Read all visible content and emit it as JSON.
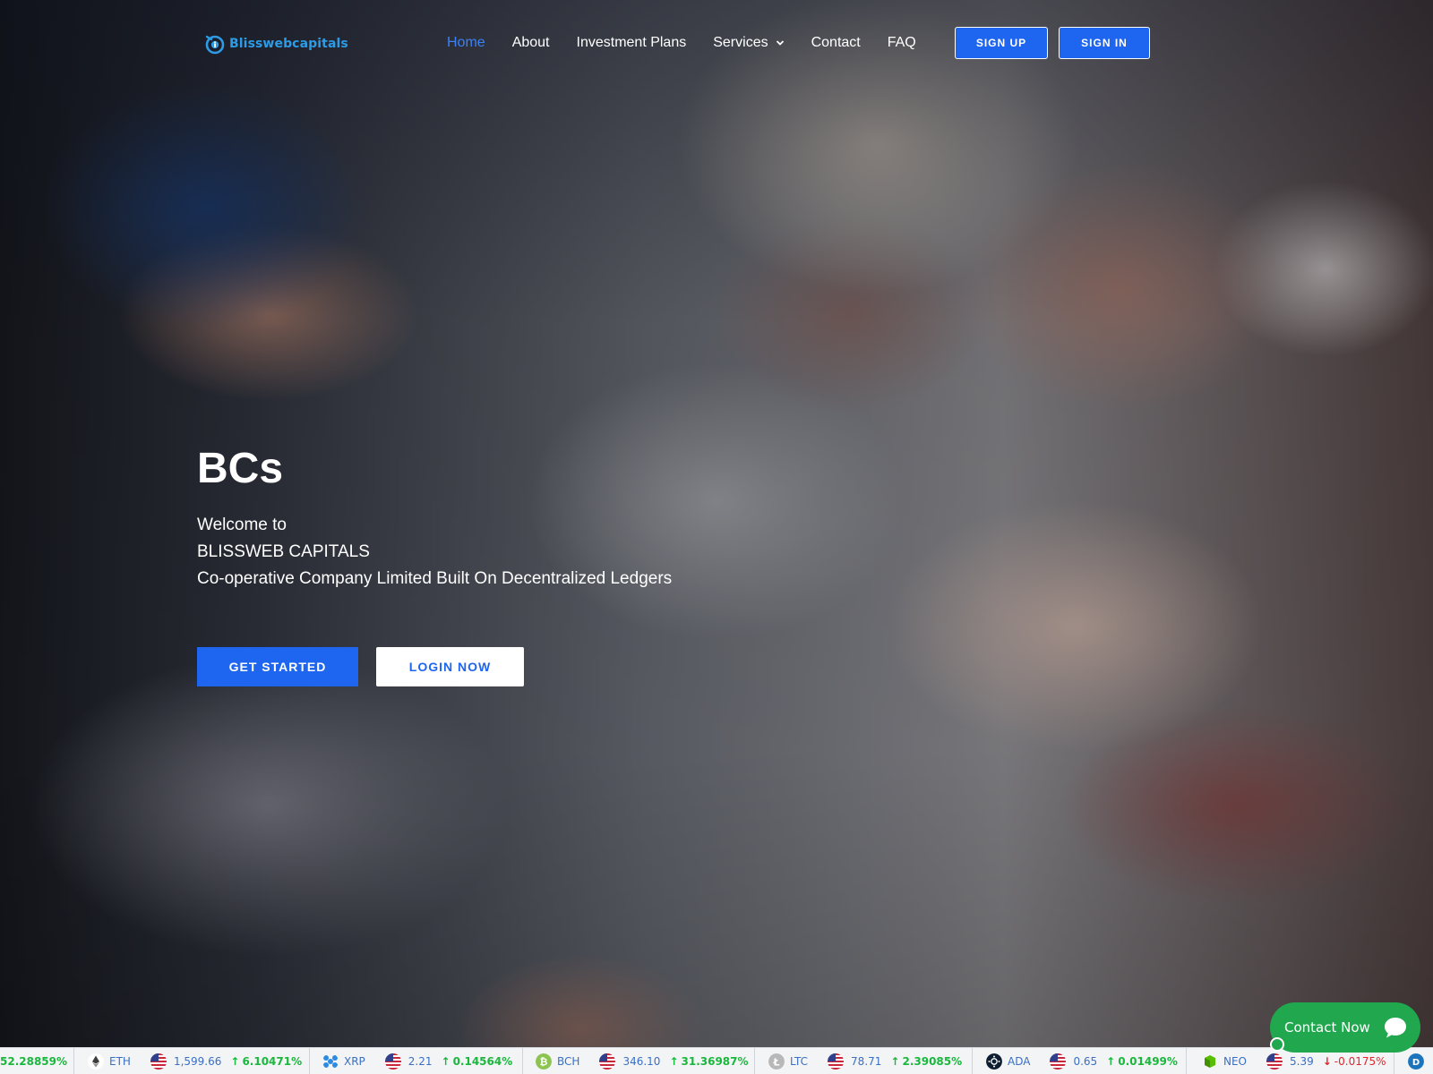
{
  "brand": {
    "name": "Blisswebcapitals",
    "color": "#2d9be6"
  },
  "nav": {
    "items": [
      {
        "label": "Home",
        "active": true
      },
      {
        "label": "About"
      },
      {
        "label": "Investment Plans"
      },
      {
        "label": "Services",
        "has_dropdown": true
      },
      {
        "label": "Contact"
      },
      {
        "label": "FAQ"
      }
    ],
    "signup": "SIGN UP",
    "signin": "SIGN IN"
  },
  "hero": {
    "title": "BCs",
    "line1": "Welcome to",
    "line2": "BLISSWEB CAPITALS",
    "line3": "Co-operative Company Limited Built On Decentralized Ledgers",
    "cta_primary": "GET STARTED",
    "cta_secondary": "LOGIN NOW"
  },
  "ticker": {
    "partial_change": "52.28859%",
    "items": [
      {
        "symbol": "ETH",
        "price": "1,599.66",
        "change": "6.10471%",
        "direction": "up",
        "icon": "eth-icon"
      },
      {
        "symbol": "XRP",
        "price": "2.21",
        "change": "0.14564%",
        "direction": "up",
        "icon": "xrp-icon"
      },
      {
        "symbol": "BCH",
        "price": "346.10",
        "change": "31.36987%",
        "direction": "up",
        "icon": "bch-icon"
      },
      {
        "symbol": "LTC",
        "price": "78.71",
        "change": "2.39085%",
        "direction": "up",
        "icon": "ltc-icon"
      },
      {
        "symbol": "ADA",
        "price": "0.65",
        "change": "0.01499%",
        "direction": "up",
        "icon": "ada-icon"
      },
      {
        "symbol": "NEO",
        "price": "5.39",
        "change": "-0.0175%",
        "direction": "down",
        "icon": "neo-icon"
      }
    ]
  },
  "contact_widget": {
    "label": "Contact Now",
    "color": "#21a84e"
  },
  "colors": {
    "accent": "#1e66f0",
    "up": "#19b83c",
    "down": "#e0262c"
  }
}
